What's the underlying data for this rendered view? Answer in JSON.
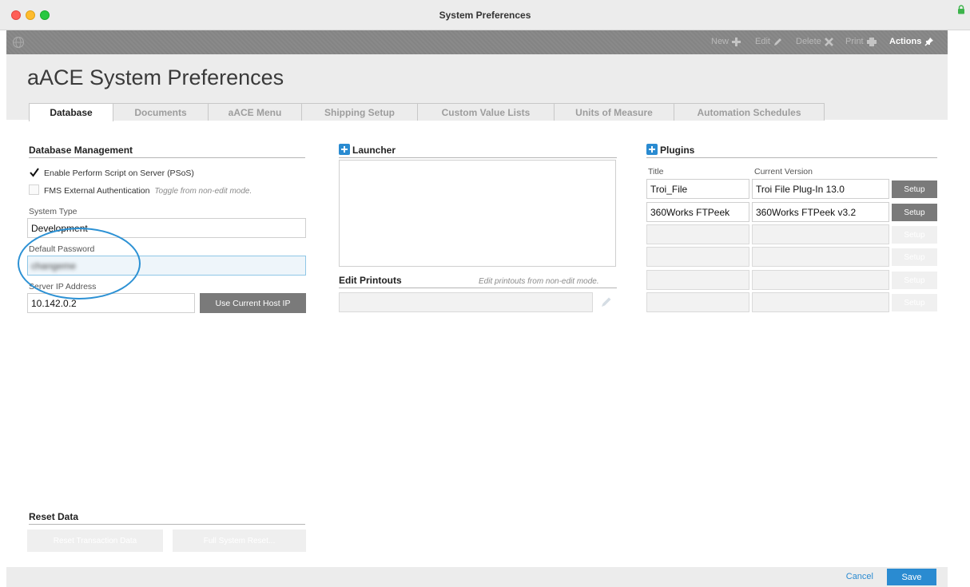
{
  "window": {
    "title": "System Preferences"
  },
  "toolbar": {
    "new_label": "New",
    "edit_label": "Edit",
    "delete_label": "Delete",
    "print_label": "Print",
    "actions_label": "Actions"
  },
  "page": {
    "title": "aACE System Preferences"
  },
  "tabs": [
    {
      "label": "Database",
      "active": true
    },
    {
      "label": "Documents"
    },
    {
      "label": "aACE Menu"
    },
    {
      "label": "Shipping Setup"
    },
    {
      "label": "Custom Value Lists"
    },
    {
      "label": "Units of Measure"
    },
    {
      "label": "Automation Schedules"
    }
  ],
  "database_management": {
    "title": "Database Management",
    "psos_label": "Enable Perform Script on Server (PSoS)",
    "psos_checked": true,
    "fms_label": "FMS External Authentication",
    "fms_hint": "Toggle from non-edit mode.",
    "fms_checked": false,
    "system_type_label": "System Type",
    "system_type_value": "Development",
    "default_password_label": "Default Password",
    "default_password_value": "changeme",
    "server_ip_label": "Server IP Address",
    "server_ip_value": "10.142.0.2",
    "use_host_ip_label": "Use Current Host IP"
  },
  "launcher": {
    "title": "Launcher"
  },
  "edit_printouts": {
    "title": "Edit Printouts",
    "hint": "Edit printouts from non-edit mode."
  },
  "plugins": {
    "title": "Plugins",
    "col_title": "Title",
    "col_version": "Current Version",
    "setup_label": "Setup",
    "rows": [
      {
        "title": "Troi_File",
        "version": "Troi File Plug-In 13.0"
      },
      {
        "title": "360Works FTPeek",
        "version": "360Works FTPeek v3.2"
      },
      {
        "title": "",
        "version": ""
      },
      {
        "title": "",
        "version": ""
      },
      {
        "title": "",
        "version": ""
      },
      {
        "title": "",
        "version": ""
      }
    ]
  },
  "reset_data": {
    "title": "Reset Data",
    "reset_transaction_label": "Reset Transaction Data",
    "full_reset_label": "Full System Reset..."
  },
  "footer": {
    "cancel_label": "Cancel",
    "save_label": "Save"
  },
  "colors": {
    "accent": "#2a8bd1",
    "toolbar": "#878787",
    "annotation": "#2c91d4"
  }
}
